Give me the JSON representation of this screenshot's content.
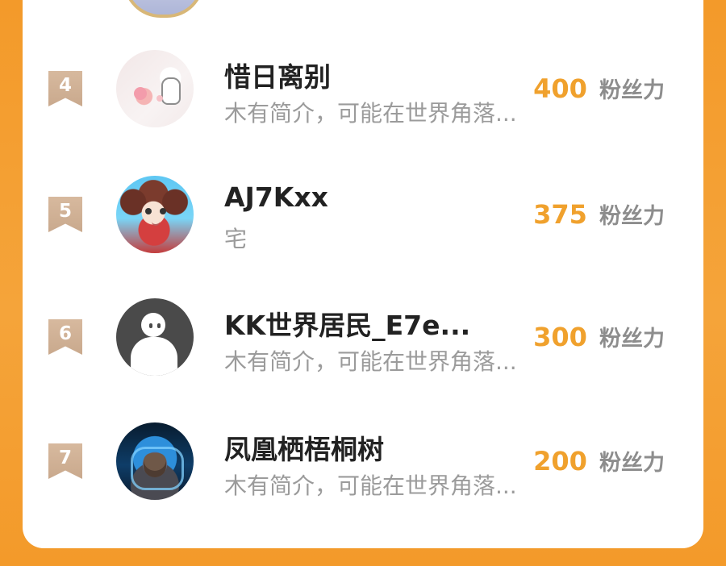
{
  "leaderboard": {
    "unit_label": "粉丝力",
    "entries": [
      {
        "rank": "4",
        "name": "惜日离别",
        "bio": "木有简介，可能在世界角落...",
        "score": "400",
        "avatar_icon": "cartoon-character-avatar"
      },
      {
        "rank": "5",
        "name": "AJ7Kxx",
        "bio": "宅",
        "score": "375",
        "avatar_icon": "anime-girl-avatar"
      },
      {
        "rank": "6",
        "name": "KK世界居民_E7e...",
        "bio": "木有简介，可能在世界角落...",
        "score": "300",
        "avatar_icon": "default-user-avatar"
      },
      {
        "rank": "7",
        "name": "凤凰栖梧桐树",
        "bio": "木有简介，可能在世界角落...",
        "score": "200",
        "avatar_icon": "robot-armor-avatar"
      }
    ]
  },
  "colors": {
    "accent": "#F0A12D",
    "background": "#F39A2A",
    "card": "#FFFFFF",
    "rank_badge": "#CFB094",
    "text_primary": "#222222",
    "text_secondary": "#9B9B9B",
    "unit_text": "#8D8D8D"
  }
}
